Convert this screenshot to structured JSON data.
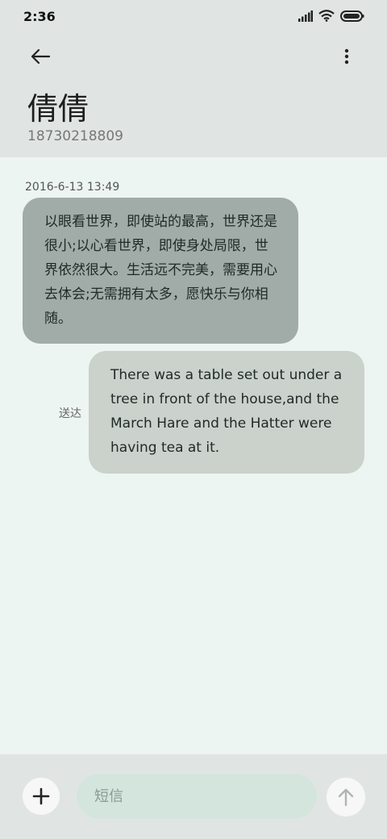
{
  "status_bar": {
    "time": "2:36",
    "icons": [
      "signal-icon",
      "wifi-icon",
      "battery-icon"
    ]
  },
  "header": {
    "back_icon": "arrow-left-icon",
    "more_icon": "more-vertical-icon",
    "contact_name": "倩倩",
    "contact_number": "18730218809"
  },
  "conversation": {
    "timestamp": "2016-6-13 13:49",
    "received_message": "以眼看世界，即使站的最高，世界还是很小;以心看世界，即使身处局限，世界依然很大。生活远不完美，需要用心去体会;无需拥有太多，愿快乐与你相随。",
    "sent_message": "There was a table set out under a tree in front of the house,and the March Hare and the Hatter were having tea at it.",
    "sent_status": "送达"
  },
  "composer": {
    "add_icon": "plus-icon",
    "placeholder": "短信",
    "value": "",
    "send_icon": "arrow-up-icon"
  },
  "colors": {
    "header_bg": "#e0e5e4",
    "chat_bg": "#edf5f2",
    "received_bubble": "#a1aba8",
    "sent_bubble": "#cbd1cb",
    "input_bg": "#d4e5de"
  }
}
